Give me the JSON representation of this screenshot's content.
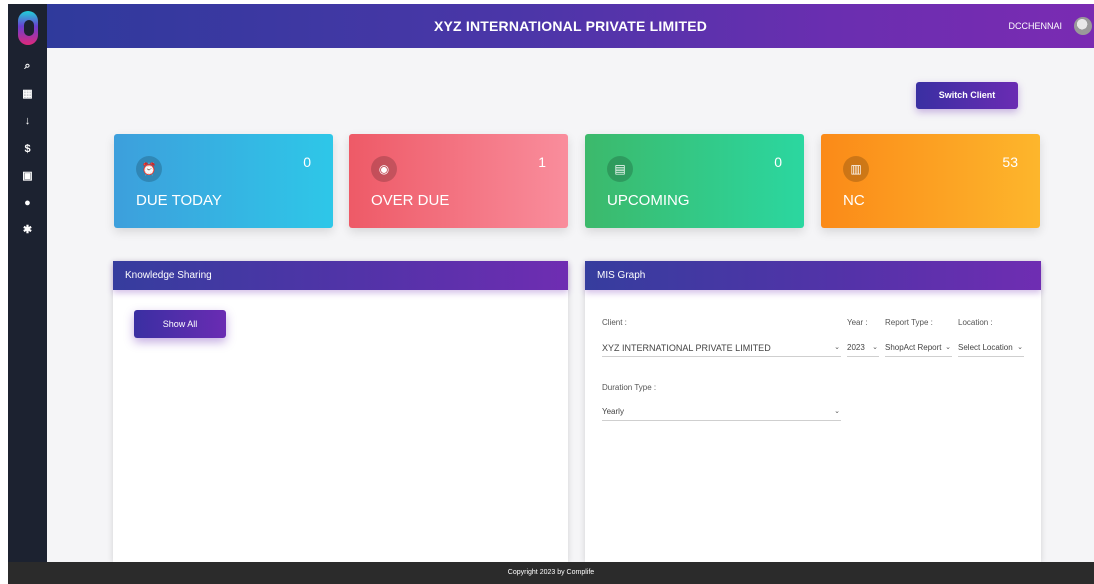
{
  "header": {
    "title": "XYZ INTERNATIONAL PRIVATE LIMITED",
    "user_name": "DCCHENNAI"
  },
  "sidebar": {
    "items": [
      {
        "name": "search-icon",
        "glyph": "⌕"
      },
      {
        "name": "dashboard-icon",
        "glyph": "▦"
      },
      {
        "name": "download-icon",
        "glyph": "↓"
      },
      {
        "name": "dollar-icon",
        "glyph": "$"
      },
      {
        "name": "document-icon",
        "glyph": "▣"
      },
      {
        "name": "user-icon",
        "glyph": "●"
      },
      {
        "name": "settings-icon",
        "glyph": "✱"
      }
    ]
  },
  "toolbar": {
    "switch_client_label": "Switch Client"
  },
  "cards": [
    {
      "label": "DUE TODAY",
      "count": "0",
      "icon": "alarm-clock-icon",
      "glyph": "⏰",
      "color": "#2ec7e8"
    },
    {
      "label": "OVER DUE",
      "count": "1",
      "icon": "alert-circle-icon",
      "glyph": "◉",
      "color": "#f98d9c"
    },
    {
      "label": "UPCOMING",
      "count": "0",
      "icon": "calendar-icon",
      "glyph": "▤",
      "color": "#2bd7a0"
    },
    {
      "label": "NC",
      "count": "53",
      "icon": "clipboard-icon",
      "glyph": "▥",
      "color": "#fdb62c"
    }
  ],
  "knowledge": {
    "title": "Knowledge Sharing",
    "show_all_label": "Show All"
  },
  "mis": {
    "title": "MIS Graph",
    "client_label": "Client :",
    "client_value": "XYZ INTERNATIONAL PRIVATE LIMITED",
    "year_label": "Year :",
    "year_value": "2023",
    "report_type_label": "Report Type :",
    "report_type_value": "ShopAct Report",
    "location_label": "Location :",
    "location_value": "Select Location",
    "duration_label": "Duration Type :",
    "duration_value": "Yearly"
  },
  "footer": {
    "text": "Copyright 2023 by Complife"
  },
  "colors": {
    "accent": "#5532a9",
    "sidebar": "#1c2230"
  }
}
